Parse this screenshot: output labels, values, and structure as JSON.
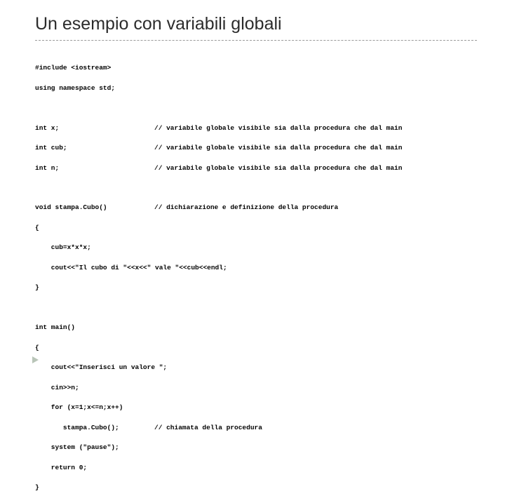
{
  "title": "Un esempio con variabili globali",
  "code": {
    "l1": "#include <iostream>",
    "l2": "using namespace std;",
    "l3a": "int x;",
    "l3b": "// variabile globale visibile sia dalla procedura che dal main",
    "l4a": "int cub;",
    "l4b": "// variabile globale visibile sia dalla procedura che dal main",
    "l5a": "int n;",
    "l5b": "// variabile globale visibile sia dalla procedura che dal main",
    "l6a": "void stampa.Cubo()",
    "l6b": "// dichiarazione e definizione della procedura",
    "l7": "{",
    "l8": "    cub=x*x*x;",
    "l9": "    cout<<\"Il cubo di \"<<x<<\" vale \"<<cub<<endl;",
    "l10": "}",
    "l11": "int main()",
    "l12": "{",
    "l13": "    cout<<\"Inserisci un valore \";",
    "l14": "    cin>>n;",
    "l15": "    for (x=1;x<=n;x++)",
    "l16a": "       stampa.Cubo();",
    "l16b": "// chiamata della procedura",
    "l17": "    system (\"pause\");",
    "l18": "    return 0;",
    "l19": "}"
  }
}
